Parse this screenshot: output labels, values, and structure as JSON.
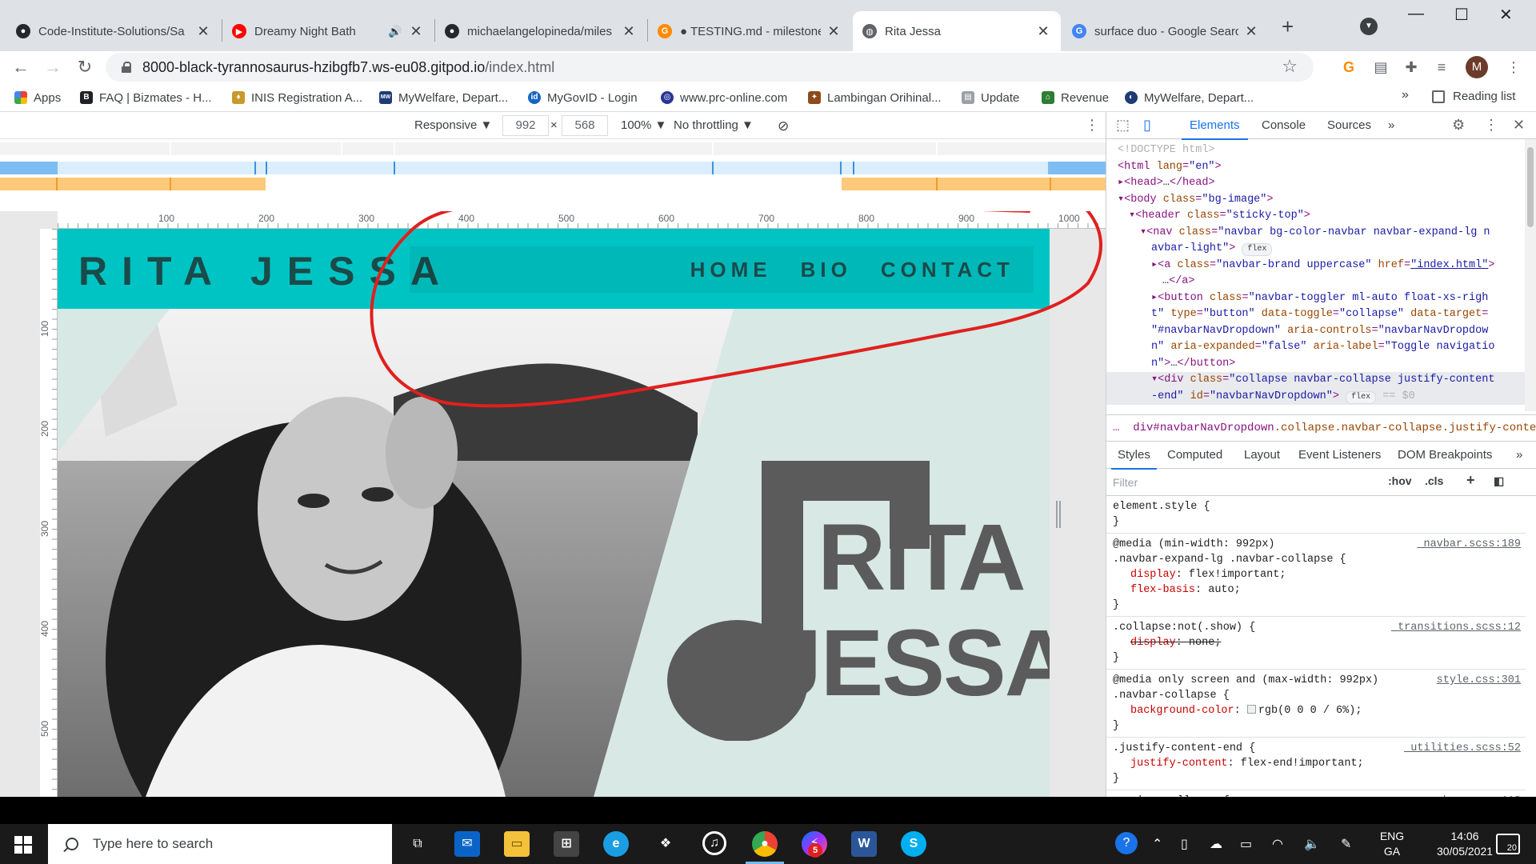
{
  "tabs": [
    {
      "title": "Code-Institute-Solutions/Sa",
      "icon": "github-icon",
      "color": "#24292e"
    },
    {
      "title": "Dreamy Night Bath",
      "icon": "youtube-icon",
      "color": "#ff0000"
    },
    {
      "title": "michaelangelopineda/miles",
      "icon": "github-icon",
      "color": "#24292e"
    },
    {
      "title": "● TESTING.md - milestones",
      "icon": "gitpod-icon",
      "color": "#ff8a00"
    },
    {
      "title": "Rita Jessa",
      "icon": "globe-icon",
      "color": "#5f6368"
    },
    {
      "title": "surface duo - Google Searc",
      "icon": "google-icon",
      "color": "#4285f4"
    }
  ],
  "address": {
    "host": "8000-black-tyrannosaurus-hzibgfb7.ws-eu08.gitpod.io",
    "path": "/index.html"
  },
  "avatar_letter": "M",
  "bookmarks": [
    {
      "label": "Apps",
      "icon": "apps-grid-icon",
      "color": "#ea4335"
    },
    {
      "label": "FAQ | Bizmates - H...",
      "icon": "bizmates-icon",
      "color": "#202124"
    },
    {
      "label": "INIS Registration A...",
      "icon": "inis-icon",
      "color": "#c79a2b"
    },
    {
      "label": "MyWelfare, Depart...",
      "icon": "mywelfare-icon",
      "color": "#1f3b73"
    },
    {
      "label": "MyGovID - Login",
      "icon": "mygovid-icon",
      "color": "#1565c0"
    },
    {
      "label": "www.prc-online.com",
      "icon": "prc-icon",
      "color": "#283593"
    },
    {
      "label": "Lambingan Orihinal...",
      "icon": "butterfly-icon",
      "color": "#8d4b1c"
    },
    {
      "label": "Update",
      "icon": "doc-icon",
      "color": "#9aa0a6"
    },
    {
      "label": "Revenue",
      "icon": "revenue-icon",
      "color": "#2e7d32"
    },
    {
      "label": "MyWelfare, Depart...",
      "icon": "mywelfare2-icon",
      "color": "#1f3b73"
    }
  ],
  "reading_list": "Reading list",
  "bookmarks_more": "»",
  "device": {
    "mode": "Responsive",
    "width": "992",
    "height": "568",
    "times": "×",
    "zoom": "100%",
    "throttle": "No throttling"
  },
  "site": {
    "brand": "RITA JESSA",
    "nav": [
      "HOME",
      "BIO",
      "CONTACT"
    ],
    "logo_line1": "RITA",
    "logo_line2": "JESSA",
    "header_color": "#00c4c4",
    "bg_color": "#d8e8e4",
    "logo_color": "#5b5b5b"
  },
  "rulers": {
    "h": [
      "100",
      "200",
      "300",
      "400",
      "500",
      "600",
      "700",
      "800",
      "900",
      "1000"
    ],
    "v": [
      "100",
      "200",
      "300",
      "400",
      "500"
    ]
  },
  "devtools": {
    "tabs": [
      "Elements",
      "Console",
      "Sources"
    ],
    "tabs_more": "»",
    "subtabs": [
      "Styles",
      "Computed",
      "Layout",
      "Event Listeners",
      "DOM Breakpoints"
    ],
    "filter_placeholder": "Filter",
    "hov": ":hov",
    "cls": ".cls",
    "breadcrumb_tag": "div#navbarNavDropdown",
    "breadcrumb_cls": ".collapse.navbar-collapse.justify-content-e",
    "breadcrumb_more": "…"
  },
  "taskbar": {
    "search_placeholder": "Type here to search",
    "lang1": "ENG",
    "lang2": "GA",
    "time": "14:06",
    "date": "30/05/2021",
    "notifications": "20",
    "badge": "5"
  }
}
